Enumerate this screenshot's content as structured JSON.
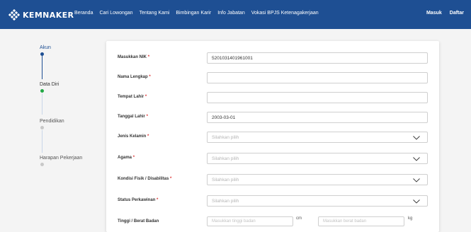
{
  "brand": {
    "name": "KEMNAKER"
  },
  "nav": {
    "links": [
      "Beranda",
      "Cari Lowongan",
      "Tentang Kami",
      "Bimbingan Karir",
      "Info Jabatan",
      "Vokasi BPJS Ketenagakerjaan"
    ],
    "login": "Masuk",
    "register": "Daftar"
  },
  "steps": [
    {
      "label": "Akun",
      "state": "done"
    },
    {
      "label": "Data Diri",
      "state": "current"
    },
    {
      "label": "Pendidikan",
      "state": "pending"
    },
    {
      "label": "Harapan Pekerjaan",
      "state": "pending"
    }
  ],
  "form": {
    "required_mark": "*",
    "nik": {
      "label": "Masukkan NIK",
      "value": "5201031401961001"
    },
    "nama": {
      "label": "Nama Lengkap",
      "value": ""
    },
    "tempat_lahir": {
      "label": "Tempat Lahir",
      "value": ""
    },
    "tanggal_lahir": {
      "label": "Tanggal Lahir",
      "value": "2003-03-01"
    },
    "jenis_kelamin": {
      "label": "Jenis Kelamin",
      "placeholder": "Silahkan pilih"
    },
    "agama": {
      "label": "Agama",
      "placeholder": "Silahkan pilih"
    },
    "kondisi_fisik": {
      "label": "Kondisi Fisik / Disabilitas",
      "placeholder": "Silahkan pilih"
    },
    "status_perkawinan": {
      "label": "Status Perkawinan",
      "placeholder": "Silahkan pilih"
    },
    "tinggi_berat": {
      "label": "Tinggi / Berat Badan",
      "tinggi_placeholder": "Masukkan tinggi badan",
      "tinggi_unit": "cm",
      "berat_placeholder": "Masukkan berat badan",
      "berat_unit": "kg"
    }
  },
  "colors": {
    "navbar": "#1e4f93",
    "step_done": "#1e4f93",
    "step_current": "#22a845",
    "step_pending": "#c8c8c8",
    "required": "#d33333"
  }
}
